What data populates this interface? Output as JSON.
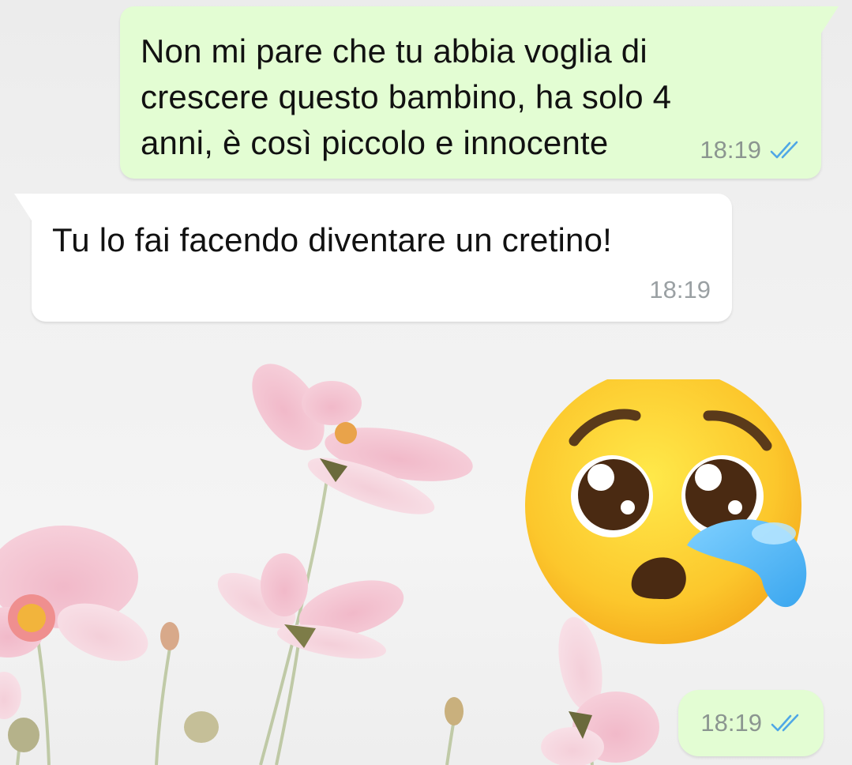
{
  "chat": {
    "messages": [
      {
        "direction": "outgoing",
        "text": "Non mi pare che tu abbia voglia di crescere questo bambino, ha solo 4 anni, è così piccolo e innocente",
        "lines": [
          "Non mi pare che tu abbia voglia di",
          "crescere questo bambino, ha solo 4",
          "anni, è così piccolo e innocente"
        ],
        "time": "18:19",
        "status_icon": "double-check-read-icon"
      },
      {
        "direction": "incoming",
        "text": "Tu lo fai facendo diventare un cretino!",
        "time": "18:19"
      },
      {
        "direction": "outgoing",
        "type": "sticker",
        "sticker_icon": "pleading-face-tear-emoji",
        "time": "18:19",
        "status_icon": "double-check-read-icon"
      }
    ]
  },
  "colors": {
    "outgoing_bubble": "#e3fdd3",
    "incoming_bubble": "#ffffff",
    "read_ticks": "#4fa7e6",
    "timestamp": "#8b9590"
  },
  "wallpaper": "pink-cosmos-flowers"
}
